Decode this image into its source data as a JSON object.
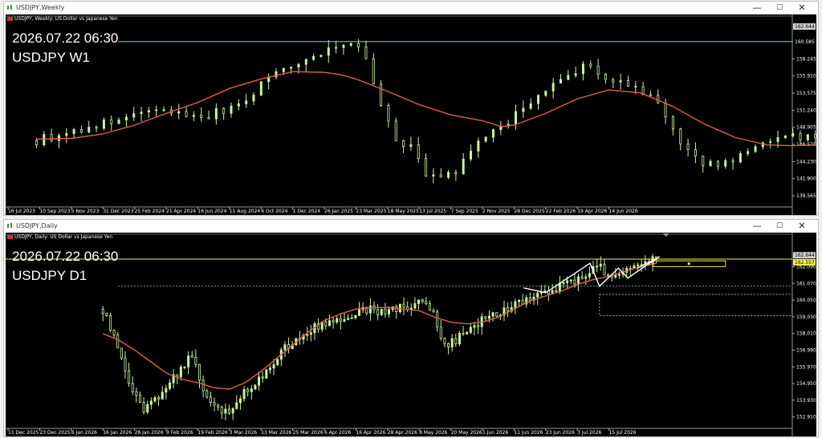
{
  "colors": {
    "bull": "#c8f5a0",
    "bear": "#c8f5a0",
    "ma": "#e0604a",
    "cyan": "#7fd7df",
    "yellow": "#f2ee55",
    "magenta": "#e040e0",
    "white": "#ffffff"
  },
  "icons": {
    "window": "chart-window-icon",
    "flag": "usd-jpy-flag-icon"
  },
  "window_controls": {
    "minimize": "—",
    "maximize": "☐",
    "close": "✕"
  },
  "weekly": {
    "window_title": "USDJPY,Weekly",
    "chart_header": "USDJPY, Weekly:  US Dollar vs Japanese Yen",
    "overlay_datetime": "2026.07.22 06:30",
    "overlay_symbol": "USDJPY W1"
  },
  "daily": {
    "window_title": "USDJPY,Daily",
    "chart_header": "USDJPY, Daily:  US Dollar vs Japanese Yen",
    "overlay_datetime": "2026.07.22 06:30",
    "overlay_symbol": "USDJPY D1"
  },
  "chart_data": [
    {
      "type": "candlestick",
      "title": "USDJPY, Weekly:  US Dollar vs Japanese Yen",
      "y_ticks": [
        "160.585",
        "158.245",
        "155.910",
        "153.575",
        "151.240",
        "148.905",
        "146.570",
        "144.230",
        "141.900",
        "139.565"
      ],
      "price_labels": [
        "162.644",
        "160.585"
      ],
      "x_ticks": [
        "16 Jul 2023",
        "10 Sep 2023",
        "5 Nov 2023",
        "31 Dec 2023",
        "25 Feb 2024",
        "21 Apr 2024",
        "16 Jun 2024",
        "11 Aug 2024",
        "6 Oct 2024",
        "1 Dec 2024",
        "26 Jan 2025",
        "23 Mar 2025",
        "18 May 2025",
        "13 Jul 2025",
        "7 Sep 2025",
        "2 Nov 2025",
        "28 Dec 2025",
        "22 Feb 2026",
        "19 Apr 2026",
        "14 Jun 2026"
      ],
      "close_path": [
        [
          0.9,
          147.1
        ],
        [
          2.5,
          148.9
        ],
        [
          3.6,
          149.9
        ],
        [
          4.8,
          151.4
        ],
        [
          6.0,
          150.2
        ],
        [
          7.4,
          152.0
        ],
        [
          8.3,
          156.2
        ],
        [
          9.2,
          157.6
        ],
        [
          10.0,
          159.5
        ],
        [
          10.8,
          160.7
        ],
        [
          11.3,
          158.5
        ],
        [
          11.7,
          152.8
        ],
        [
          12.2,
          147.3
        ],
        [
          12.8,
          146.3
        ],
        [
          13.3,
          141.6
        ],
        [
          14.2,
          143.0
        ],
        [
          15.0,
          147.5
        ],
        [
          15.8,
          149.5
        ],
        [
          16.5,
          152.5
        ],
        [
          17.4,
          155.0
        ],
        [
          18.2,
          157.5
        ],
        [
          18.9,
          155.7
        ],
        [
          19.7,
          154.5
        ],
        [
          20.6,
          152.0
        ],
        [
          21.3,
          146.6
        ],
        [
          22.0,
          143.5
        ],
        [
          22.8,
          144.3
        ],
        [
          23.6,
          146.0
        ],
        [
          24.5,
          148.2
        ],
        [
          25.4,
          147.3
        ],
        [
          26.3,
          148.8
        ],
        [
          27.1,
          152.5
        ],
        [
          28.1,
          152.5
        ],
        [
          29.1,
          155.5
        ],
        [
          30.1,
          153.7
        ],
        [
          31.1,
          153.0
        ],
        [
          32.1,
          156.5
        ],
        [
          33.1,
          158.0
        ],
        [
          34.1,
          159.8
        ],
        [
          34.7,
          160.1
        ],
        [
          35.3,
          156.2
        ],
        [
          35.7,
          157.0
        ],
        [
          36.4,
          158.3
        ],
        [
          37.1,
          159.7
        ],
        [
          37.6,
          162.0
        ]
      ],
      "ma_path": [
        [
          0.9,
          147.3
        ],
        [
          2.0,
          147.4
        ],
        [
          3.0,
          148.0
        ],
        [
          4.0,
          149.2
        ],
        [
          5.0,
          150.8
        ],
        [
          6.0,
          152.3
        ],
        [
          7.0,
          154.2
        ],
        [
          8.0,
          155.5
        ],
        [
          9.0,
          156.5
        ],
        [
          10.0,
          156.4
        ],
        [
          10.5,
          156.1
        ],
        [
          11.0,
          155.5
        ],
        [
          12.0,
          153.8
        ],
        [
          13.0,
          152.0
        ],
        [
          14.0,
          150.6
        ],
        [
          15.0,
          149.8
        ],
        [
          15.6,
          149.0
        ],
        [
          16.0,
          149.2
        ],
        [
          17.0,
          150.8
        ],
        [
          18.0,
          152.8
        ],
        [
          19.0,
          154.0
        ],
        [
          20.0,
          153.6
        ],
        [
          21.0,
          151.8
        ],
        [
          22.0,
          149.4
        ],
        [
          23.0,
          147.5
        ],
        [
          24.0,
          146.5
        ],
        [
          24.8,
          146.4
        ],
        [
          25.5,
          146.5
        ],
        [
          26.0,
          146.7
        ],
        [
          27.0,
          148.0
        ],
        [
          28.0,
          149.3
        ],
        [
          29.0,
          150.5
        ],
        [
          30.0,
          151.8
        ],
        [
          31.0,
          153.0
        ],
        [
          32.0,
          154.6
        ],
        [
          33.0,
          156.0
        ],
        [
          34.0,
          157.0
        ],
        [
          35.0,
          157.6
        ],
        [
          36.0,
          158.3
        ],
        [
          37.0,
          159.2
        ],
        [
          38.0,
          159.9
        ]
      ]
    },
    {
      "type": "candlestick",
      "title": "USDJPY, Daily:  US Dollar vs Japanese Yen",
      "y_ticks": [
        "162.090",
        "161.070",
        "160.050",
        "159.030",
        "158.010",
        "156.990",
        "155.970",
        "154.950",
        "153.930",
        "152.910"
      ],
      "price_labels": [
        "162.644",
        "162.557"
      ],
      "x_ticks": [
        "11 Dec 2025",
        "23 Dec 2025",
        "6 Jan 2026",
        "16 Jan 2026",
        "28 Jan 2026",
        "9 Feb 2026",
        "19 Feb 2026",
        "3 Mar 2026",
        "13 Mar 2026",
        "25 Mar 2026",
        "6 Apr 2026",
        "16 Apr 2026",
        "28 Apr 2026",
        "8 May 2026",
        "20 May 2026",
        "1 Jun 2026",
        "11 Jun 2026",
        "23 Jun 2026",
        "3 Jul 2026",
        "15 Jul 2026"
      ],
      "close_path": [
        [
          3.0,
          159.5
        ],
        [
          3.4,
          157.5
        ],
        [
          3.8,
          155.0
        ],
        [
          4.3,
          153.4
        ],
        [
          4.8,
          154.3
        ],
        [
          5.3,
          155.5
        ],
        [
          5.8,
          156.8
        ],
        [
          6.2,
          154.2
        ],
        [
          6.8,
          153.0
        ],
        [
          7.3,
          154.0
        ],
        [
          7.8,
          155.0
        ],
        [
          8.3,
          156.0
        ],
        [
          8.8,
          157.2
        ],
        [
          9.3,
          158.0
        ],
        [
          9.8,
          158.5
        ],
        [
          10.3,
          158.7
        ],
        [
          11.0,
          159.2
        ],
        [
          11.5,
          159.5
        ],
        [
          12.0,
          159.3
        ],
        [
          12.5,
          159.6
        ],
        [
          13.0,
          159.8
        ],
        [
          13.4,
          159.5
        ],
        [
          13.8,
          157.2
        ],
        [
          14.3,
          157.8
        ],
        [
          14.8,
          158.6
        ],
        [
          15.3,
          159.2
        ],
        [
          15.8,
          159.5
        ],
        [
          16.3,
          160.0
        ],
        [
          16.8,
          160.4
        ],
        [
          17.3,
          160.8
        ],
        [
          17.8,
          161.2
        ],
        [
          18.3,
          161.6
        ],
        [
          18.7,
          162.2
        ],
        [
          19.0,
          161.4
        ],
        [
          19.5,
          161.7
        ],
        [
          20.0,
          162.4
        ],
        [
          20.5,
          162.6
        ]
      ],
      "ma_path": [
        [
          3.0,
          158.0
        ],
        [
          3.5,
          157.6
        ],
        [
          4.0,
          157.0
        ],
        [
          4.5,
          156.3
        ],
        [
          5.0,
          155.6
        ],
        [
          5.5,
          155.2
        ],
        [
          6.0,
          155.0
        ],
        [
          6.5,
          154.7
        ],
        [
          7.0,
          154.6
        ],
        [
          7.5,
          155.0
        ],
        [
          8.0,
          155.7
        ],
        [
          8.5,
          156.5
        ],
        [
          9.0,
          157.3
        ],
        [
          9.5,
          158.1
        ],
        [
          10.0,
          158.8
        ],
        [
          10.5,
          159.2
        ],
        [
          11.0,
          159.5
        ],
        [
          11.5,
          159.6
        ],
        [
          12.0,
          159.6
        ],
        [
          12.5,
          159.5
        ],
        [
          13.0,
          159.4
        ],
        [
          13.5,
          159.0
        ],
        [
          14.0,
          158.7
        ],
        [
          14.5,
          158.6
        ],
        [
          15.0,
          158.7
        ],
        [
          15.5,
          159.0
        ],
        [
          16.0,
          159.5
        ],
        [
          16.5,
          160.0
        ],
        [
          17.0,
          160.3
        ],
        [
          17.5,
          160.6
        ],
        [
          18.0,
          161.0
        ],
        [
          18.5,
          161.3
        ],
        [
          19.0,
          161.5
        ],
        [
          19.5,
          161.8
        ],
        [
          20.0,
          162.1
        ],
        [
          20.5,
          162.3
        ]
      ]
    }
  ]
}
